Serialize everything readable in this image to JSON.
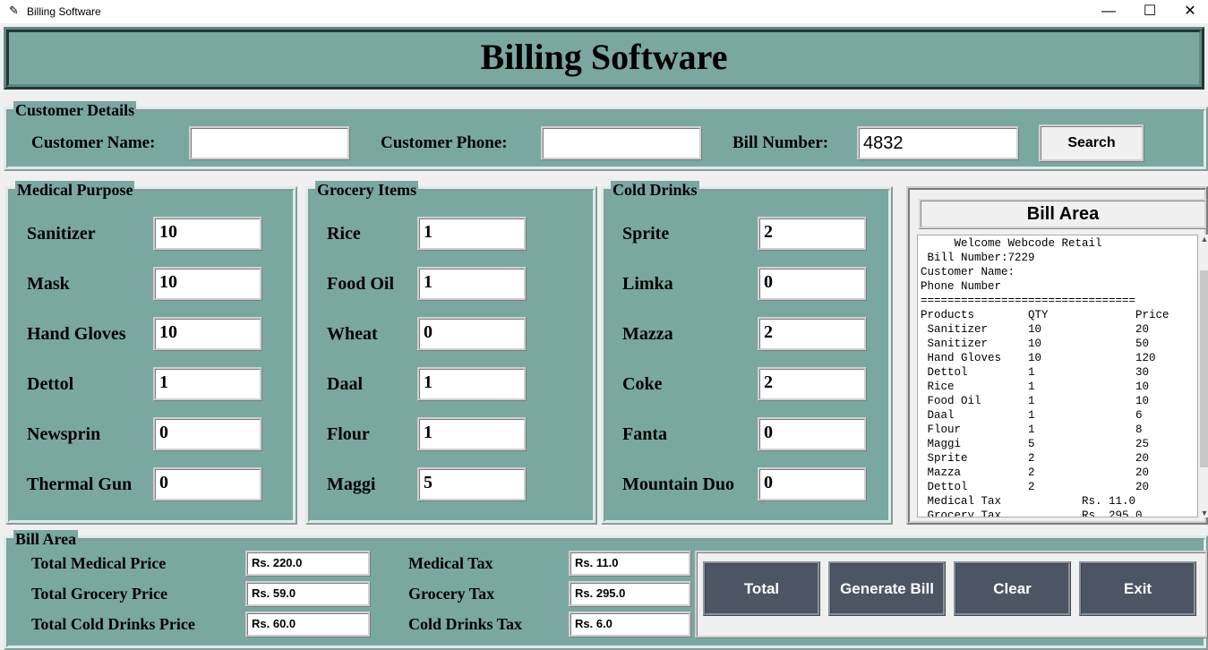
{
  "window": {
    "title": "Billing Software",
    "minimize": "—",
    "maximize": "☐",
    "close": "✕"
  },
  "header": {
    "title": "Billing Software"
  },
  "customer": {
    "section_label": "Customer Details",
    "name_label": "Customer Name:",
    "name_value": "",
    "phone_label": "Customer Phone:",
    "phone_value": "",
    "bill_label": "Bill Number:",
    "bill_value": "4832",
    "search_label": "Search"
  },
  "medical": {
    "section_label": "Medical Purpose",
    "items": [
      {
        "label": "Sanitizer",
        "value": "10"
      },
      {
        "label": "Mask",
        "value": "10"
      },
      {
        "label": "Hand Gloves",
        "value": "10"
      },
      {
        "label": "Dettol",
        "value": "1"
      },
      {
        "label": "Newsprin",
        "value": "0"
      },
      {
        "label": "Thermal Gun",
        "value": "0"
      }
    ]
  },
  "grocery": {
    "section_label": "Grocery Items",
    "items": [
      {
        "label": "Rice",
        "value": "1"
      },
      {
        "label": "Food Oil",
        "value": "1"
      },
      {
        "label": "Wheat",
        "value": "0"
      },
      {
        "label": "Daal",
        "value": "1"
      },
      {
        "label": "Flour",
        "value": "1"
      },
      {
        "label": "Maggi",
        "value": "5"
      }
    ]
  },
  "drinks": {
    "section_label": "Cold Drinks",
    "items": [
      {
        "label": "Sprite",
        "value": "2"
      },
      {
        "label": "Limka",
        "value": "0"
      },
      {
        "label": "Mazza",
        "value": "2"
      },
      {
        "label": "Coke",
        "value": "2"
      },
      {
        "label": "Fanta",
        "value": "0"
      },
      {
        "label": "Mountain Duo",
        "value": "0"
      }
    ]
  },
  "bill_area": {
    "title": "Bill Area",
    "lines": [
      "     Welcome Webcode Retail",
      " Bill Number:7229",
      "Customer Name:",
      "Phone Number",
      "================================",
      "Products        QTY             Price",
      " Sanitizer      10              20",
      " Sanitizer      10              50",
      " Hand Gloves    10              120",
      " Dettol         1               30",
      " Rice           1               10",
      " Food Oil       1               10",
      " Daal           1               6",
      " Flour          1               8",
      " Maggi          5               25",
      " Sprite         2               20",
      " Mazza          2               20",
      " Dettol         2               20",
      " Medical Tax            Rs. 11.0",
      " Grocery Tax            Rs. 295.0"
    ]
  },
  "totals": {
    "section_label": "Bill Area",
    "medical_price_label": "Total Medical Price",
    "medical_price_value": "Rs. 220.0",
    "grocery_price_label": "Total Grocery Price",
    "grocery_price_value": "Rs. 59.0",
    "drinks_price_label": "Total Cold Drinks Price",
    "drinks_price_value": "Rs. 60.0",
    "medical_tax_label": "Medical Tax",
    "medical_tax_value": "Rs. 11.0",
    "grocery_tax_label": "Grocery Tax",
    "grocery_tax_value": "Rs. 295.0",
    "drinks_tax_label": "Cold Drinks Tax",
    "drinks_tax_value": "Rs. 6.0"
  },
  "actions": {
    "total": "Total",
    "generate": "Generate Bill",
    "clear": "Clear",
    "exit": "Exit"
  }
}
